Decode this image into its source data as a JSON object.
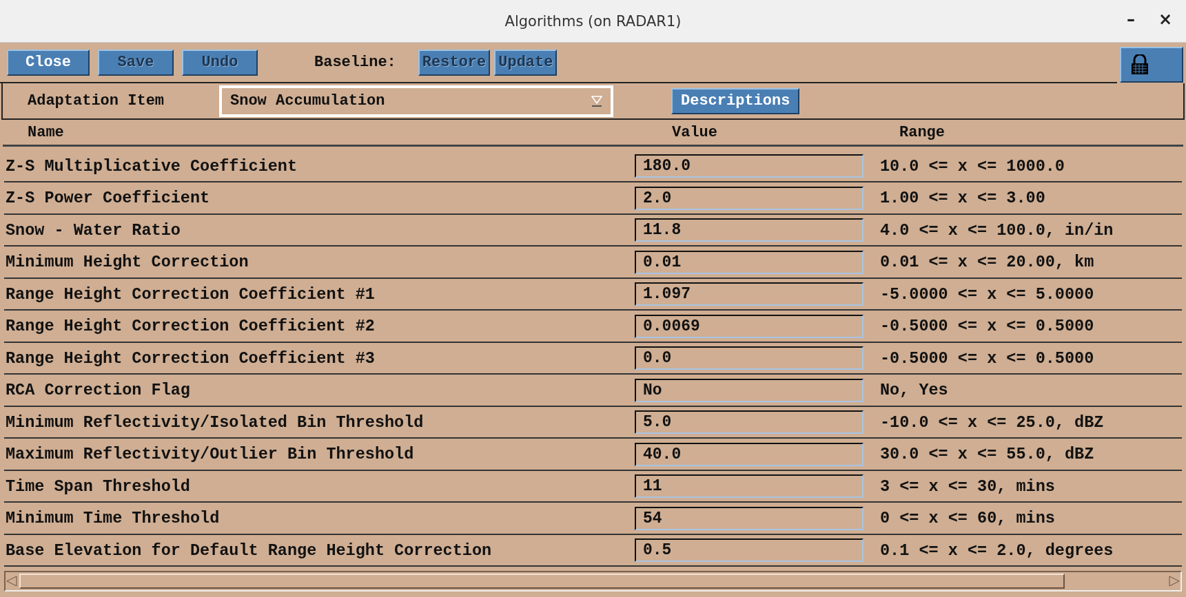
{
  "window": {
    "title": "Algorithms (on RADAR1)",
    "controls": [
      "–",
      "×"
    ]
  },
  "toolbar": {
    "buttons": [
      {
        "label": "Close",
        "disabled": false
      },
      {
        "label": "Save",
        "disabled": true
      },
      {
        "label": "Undo",
        "disabled": true
      }
    ],
    "baseline_label": "Baseline:",
    "baseline_buttons": [
      {
        "label": "Restore",
        "disabled": true
      },
      {
        "label": "Update",
        "disabled": true
      }
    ]
  },
  "adaptation": {
    "label": "Adaptation Item",
    "value": "Snow Accumulation",
    "button": "Descriptions"
  },
  "table": {
    "columns": [
      "Name",
      "Value",
      "Range"
    ],
    "rows": [
      {
        "name": "Z-S Multiplicative Coefficient",
        "value": "180.0",
        "range": "10.0 <= x <= 1000.0"
      },
      {
        "name": "Z-S Power Coefficient",
        "value": "2.0",
        "range": "1.00 <= x <= 3.00"
      },
      {
        "name": "Snow - Water Ratio",
        "value": "11.8",
        "range": "4.0 <= x <= 100.0, in/in"
      },
      {
        "name": "Minimum Height Correction",
        "value": "0.01",
        "range": "0.01 <= x <= 20.00, km"
      },
      {
        "name": "Range Height Correction Coefficient #1",
        "value": "1.097",
        "range": "-5.0000 <= x <= 5.0000"
      },
      {
        "name": "Range Height Correction Coefficient #2",
        "value": "0.0069",
        "range": "-0.5000 <= x <= 0.5000"
      },
      {
        "name": "Range Height Correction Coefficient #3",
        "value": "0.0",
        "range": "-0.5000 <= x <= 0.5000"
      },
      {
        "name": "RCA Correction Flag",
        "value": "No",
        "range": "No, Yes"
      },
      {
        "name": "Minimum Reflectivity/Isolated Bin Threshold",
        "value": "5.0",
        "range": "-10.0 <= x <= 25.0, dBZ"
      },
      {
        "name": "Maximum Reflectivity/Outlier Bin Threshold",
        "value": "40.0",
        "range": "30.0 <= x <= 55.0, dBZ"
      },
      {
        "name": "Time Span Threshold",
        "value": "11",
        "range": "3 <= x <= 30, mins"
      },
      {
        "name": "Minimum Time Threshold",
        "value": "54",
        "range": "0 <= x <= 60, mins"
      },
      {
        "name": "Base Elevation for Default Range Height Correction",
        "value": "0.5",
        "range": "0.1 <= x <= 2.0, degrees"
      }
    ]
  }
}
